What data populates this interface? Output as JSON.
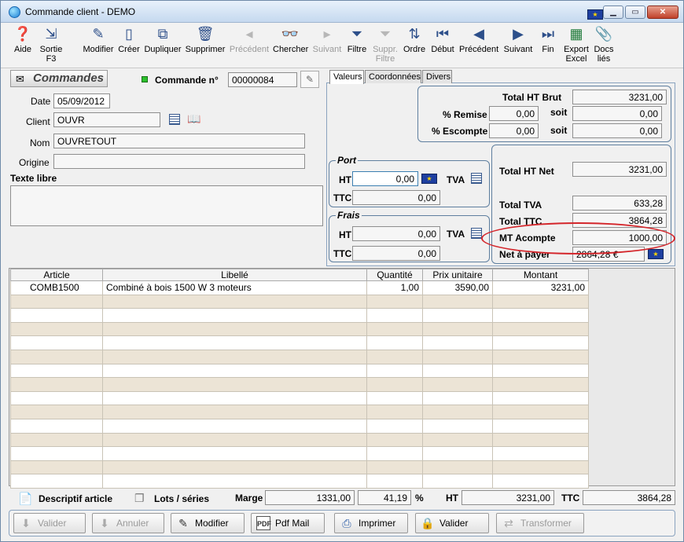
{
  "window": {
    "title": "Commande client - DEMO"
  },
  "toolbar": [
    {
      "label": "Aide",
      "icon": "help-icon",
      "enabled": true
    },
    {
      "label": "Sortie\nF3",
      "icon": "exit-icon",
      "enabled": true
    },
    {
      "label": "Modifier",
      "icon": "pencil-icon",
      "enabled": true
    },
    {
      "label": "Créer",
      "icon": "new-page-icon",
      "enabled": true
    },
    {
      "label": "Dupliquer",
      "icon": "duplicate-icon",
      "enabled": true
    },
    {
      "label": "Supprimer",
      "icon": "trash-icon",
      "enabled": true
    },
    {
      "label": "Précédent",
      "icon": "prev-small-icon",
      "enabled": false
    },
    {
      "label": "Chercher",
      "icon": "binoculars-icon",
      "enabled": true
    },
    {
      "label": "Suivant",
      "icon": "next-small-icon",
      "enabled": false
    },
    {
      "label": "Filtre",
      "icon": "funnel-icon",
      "enabled": true
    },
    {
      "label": "Suppr.\nFiltre",
      "icon": "funnel-remove-icon",
      "enabled": false
    },
    {
      "label": "Ordre",
      "icon": "order-icon",
      "enabled": true
    },
    {
      "label": "Début",
      "icon": "first-icon",
      "enabled": true
    },
    {
      "label": "Précédent",
      "icon": "prev-icon",
      "enabled": true
    },
    {
      "label": "Suivant",
      "icon": "next-icon",
      "enabled": true
    },
    {
      "label": "Fin",
      "icon": "last-icon",
      "enabled": true
    },
    {
      "label": "Export\nExcel",
      "icon": "excel-icon",
      "enabled": true
    },
    {
      "label": "Docs\nliés",
      "icon": "paperclip-icon",
      "enabled": true
    }
  ],
  "header": {
    "section_title": "Commandes",
    "order_label": "Commande n°",
    "order_number": "00000084",
    "date_label": "Date",
    "date_value": "05/09/2012",
    "client_label": "Client",
    "client_value": "OUVR",
    "nom_label": "Nom",
    "nom_value": "OUVRETOUT",
    "origine_label": "Origine",
    "origine_value": "",
    "texte_libre_label": "Texte libre",
    "texte_libre_value": ""
  },
  "tabs": [
    "Valeurs",
    "Coordonnées",
    "Divers"
  ],
  "values": {
    "total_ht_brut_label": "Total HT Brut",
    "total_ht_brut": "3231,00",
    "remise_label": "% Remise",
    "remise_pct": "0,00",
    "remise_soit_label": "soit",
    "remise_soit": "0,00",
    "escompte_label": "% Escompte",
    "escompte_pct": "0,00",
    "escompte_soit_label": "soit",
    "escompte_soit": "0,00",
    "port_title": "Port",
    "port_ht_label": "HT",
    "port_ht": "0,00",
    "port_tva_label": "TVA",
    "port_ttc_label": "TTC",
    "port_ttc": "0,00",
    "frais_title": "Frais",
    "frais_ht_label": "HT",
    "frais_ht": "0,00",
    "frais_tva_label": "TVA",
    "frais_ttc_label": "TTC",
    "frais_ttc": "0,00",
    "total_ht_net_label": "Total HT Net",
    "total_ht_net": "3231,00",
    "total_tva_label": "Total TVA",
    "total_tva": "633,28",
    "total_ttc_label": "Total TTC",
    "total_ttc": "3864,28",
    "mt_acompte_label": "MT Acompte",
    "mt_acompte": "1000,00",
    "net_a_payer_label": "Net à payer",
    "net_a_payer": "2864,28 €",
    "euro_flag": "€"
  },
  "grid": {
    "add_symbol": "+",
    "columns": [
      "Article",
      "Libellé",
      "Quantité",
      "Prix unitaire",
      "Montant"
    ],
    "rows": [
      {
        "article": "COMB1500",
        "libelle": "Combiné à bois 1500 W 3 moteurs",
        "quantite": "1,00",
        "prix": "3590,00",
        "montant": "3231,00"
      }
    ],
    "empty_rows": 14
  },
  "footer": {
    "descriptif_label": "Descriptif article",
    "lots_label": "Lots / séries",
    "marge_label": "Marge",
    "marge_value": "1331,00",
    "marge_pct": "41,19",
    "pct_symbol": "%",
    "ht_label": "HT",
    "ht_value": "3231,00",
    "ttc_label": "TTC",
    "ttc_value": "3864,28"
  },
  "actions": [
    {
      "label": "Valider",
      "icon": "validate-icon",
      "enabled": false
    },
    {
      "label": "Annuler",
      "icon": "cancel-icon",
      "enabled": false
    },
    {
      "label": "Modifier",
      "icon": "pencil-icon",
      "enabled": true
    },
    {
      "label": "Pdf Mail",
      "icon": "pdf-icon",
      "enabled": true
    },
    {
      "label": "Imprimer",
      "icon": "printer-icon",
      "enabled": true
    },
    {
      "label": "Valider",
      "icon": "lock-validate-icon",
      "enabled": true
    },
    {
      "label": "Transformer",
      "icon": "transform-icon",
      "enabled": false
    }
  ],
  "colors": {
    "highlight_ellipse": "#d4262b",
    "row_alt": "#ece4d6",
    "frame_border": "#5f7f9f"
  }
}
